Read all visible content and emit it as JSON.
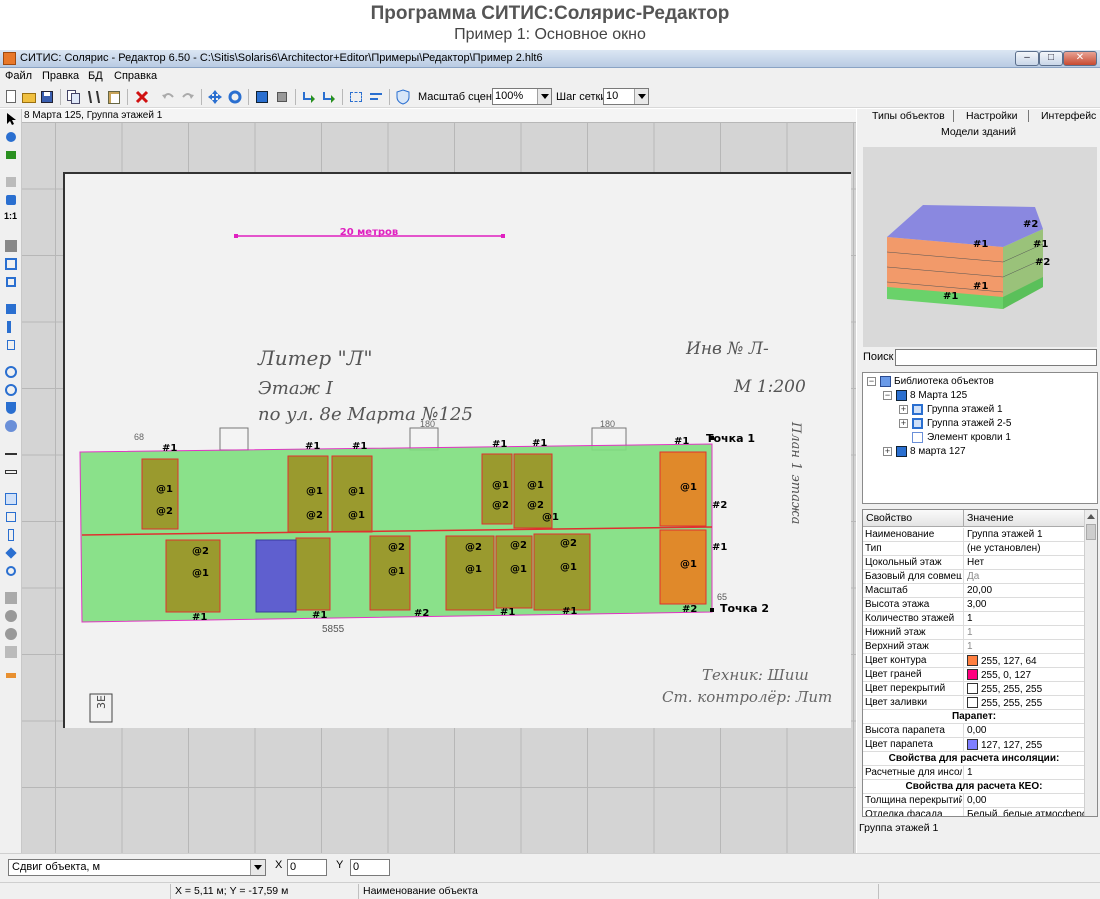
{
  "page_header": {
    "title": "Программа СИТИС:Солярис-Редактор",
    "subtitle": "Пример 1: Основное окно"
  },
  "window": {
    "title": "СИТИС: Солярис - Редактор 6.50 - C:\\Sitis\\Solaris6\\Architector+Editor\\Примеры\\Редактор\\Пример 2.hlt6",
    "min_glyph": "–",
    "max_glyph": "□",
    "close_glyph": "✕"
  },
  "menu": {
    "items": [
      "Файл",
      "Правка",
      "БД",
      "Справка"
    ]
  },
  "toolbar": {
    "scale_label": "Масштаб сцены",
    "scale_value": "100%",
    "grid_label": "Шаг сетки",
    "grid_value": "10"
  },
  "canvas": {
    "breadcrumb": "8 Марта 125, Группа этажей 1",
    "scale_bar_label": "20 метров",
    "point1_label": "Точка 1",
    "point2_label": "Точка 2",
    "handwriting_1": "Литер \"Л\"",
    "handwriting_2": "Этаж I",
    "handwriting_3": "по ул. 8е Марта №125",
    "handwriting_4": "Инв № Л-",
    "handwriting_5": "М 1:200",
    "handwriting_6": "План 1 этажа",
    "handwriting_7": "Техник: Шиш",
    "handwriting_8": "Ст. контролёр: Лит",
    "handwriting_9": "3Е",
    "dim_1": "5855",
    "dim_2": "180",
    "dim_3": "180",
    "dim_4": "65",
    "dim_5": "68"
  },
  "right_panel": {
    "tabs": [
      "Типы объектов",
      "Настройки",
      "Интерфейс"
    ],
    "models_title": "Модели зданий",
    "search_label": "Поиск",
    "search_value": "",
    "tree": {
      "root": "Библиотека объектов",
      "building1": "8 Марта 125",
      "group1": "Группа этажей 1",
      "group2": "Группа этажей 2-5",
      "roof": "Элемент кровли 1",
      "building2": "8 марта 127"
    },
    "props_header": {
      "key": "Свойство",
      "value": "Значение"
    },
    "props": [
      {
        "k": "Наименование",
        "v": "Группа этажей 1"
      },
      {
        "k": "Тип",
        "v": "(не установлен)"
      },
      {
        "k": "Цокольный этаж",
        "v": "Нет"
      },
      {
        "k": "Базовый для совмеще",
        "v": "Да"
      },
      {
        "k": "Масштаб",
        "v": "20,00"
      },
      {
        "k": "Высота этажа",
        "v": "3,00"
      },
      {
        "k": "Количество этажей",
        "v": "1"
      },
      {
        "k": "Нижний этаж",
        "v": "1"
      },
      {
        "k": "Верхний этаж",
        "v": "1"
      },
      {
        "k": "Цвет контура",
        "v": "255, 127, 64",
        "color": "#ff7f40"
      },
      {
        "k": "Цвет граней",
        "v": "255, 0, 127",
        "color": "#ff007f"
      },
      {
        "k": "Цвет перекрытий",
        "v": "255, 255, 255",
        "color": "#ffffff"
      },
      {
        "k": "Цвет заливки",
        "v": "255, 255, 255",
        "color": "#ffffff"
      },
      {
        "section": "Парапет:"
      },
      {
        "k": "Высота парапета",
        "v": "0,00"
      },
      {
        "k": "Цвет парапета",
        "v": "127, 127, 255",
        "color": "#7f7fff"
      },
      {
        "section": "Свойства для расчета инсоляции:"
      },
      {
        "k": "Расчетные для инсоля",
        "v": "1"
      },
      {
        "section": "Свойства для расчета КЕО:"
      },
      {
        "k": "Толщина перекрытий",
        "v": "0,00"
      },
      {
        "k": "Отделка фасада",
        "v": "Белый, белые атмосферос"
      }
    ],
    "footer": "Группа этажей 1"
  },
  "bottom": {
    "shift_combo": "Сдвиг объекта, м",
    "x_label": "X",
    "x_value": "0",
    "y_label": "Y",
    "y_value": "0"
  },
  "status": {
    "coords": "X = 5,11 м; Y = -17,59 м",
    "object_name": "Наименование объекта"
  },
  "colors": {
    "green_fill": "#7fe07f",
    "olive_fill": "#9a9a2e",
    "orange_fill": "#e0892a",
    "blue_fill": "#5f5fcf",
    "outline_red": "#e03030",
    "magenta": "#e020c0"
  }
}
